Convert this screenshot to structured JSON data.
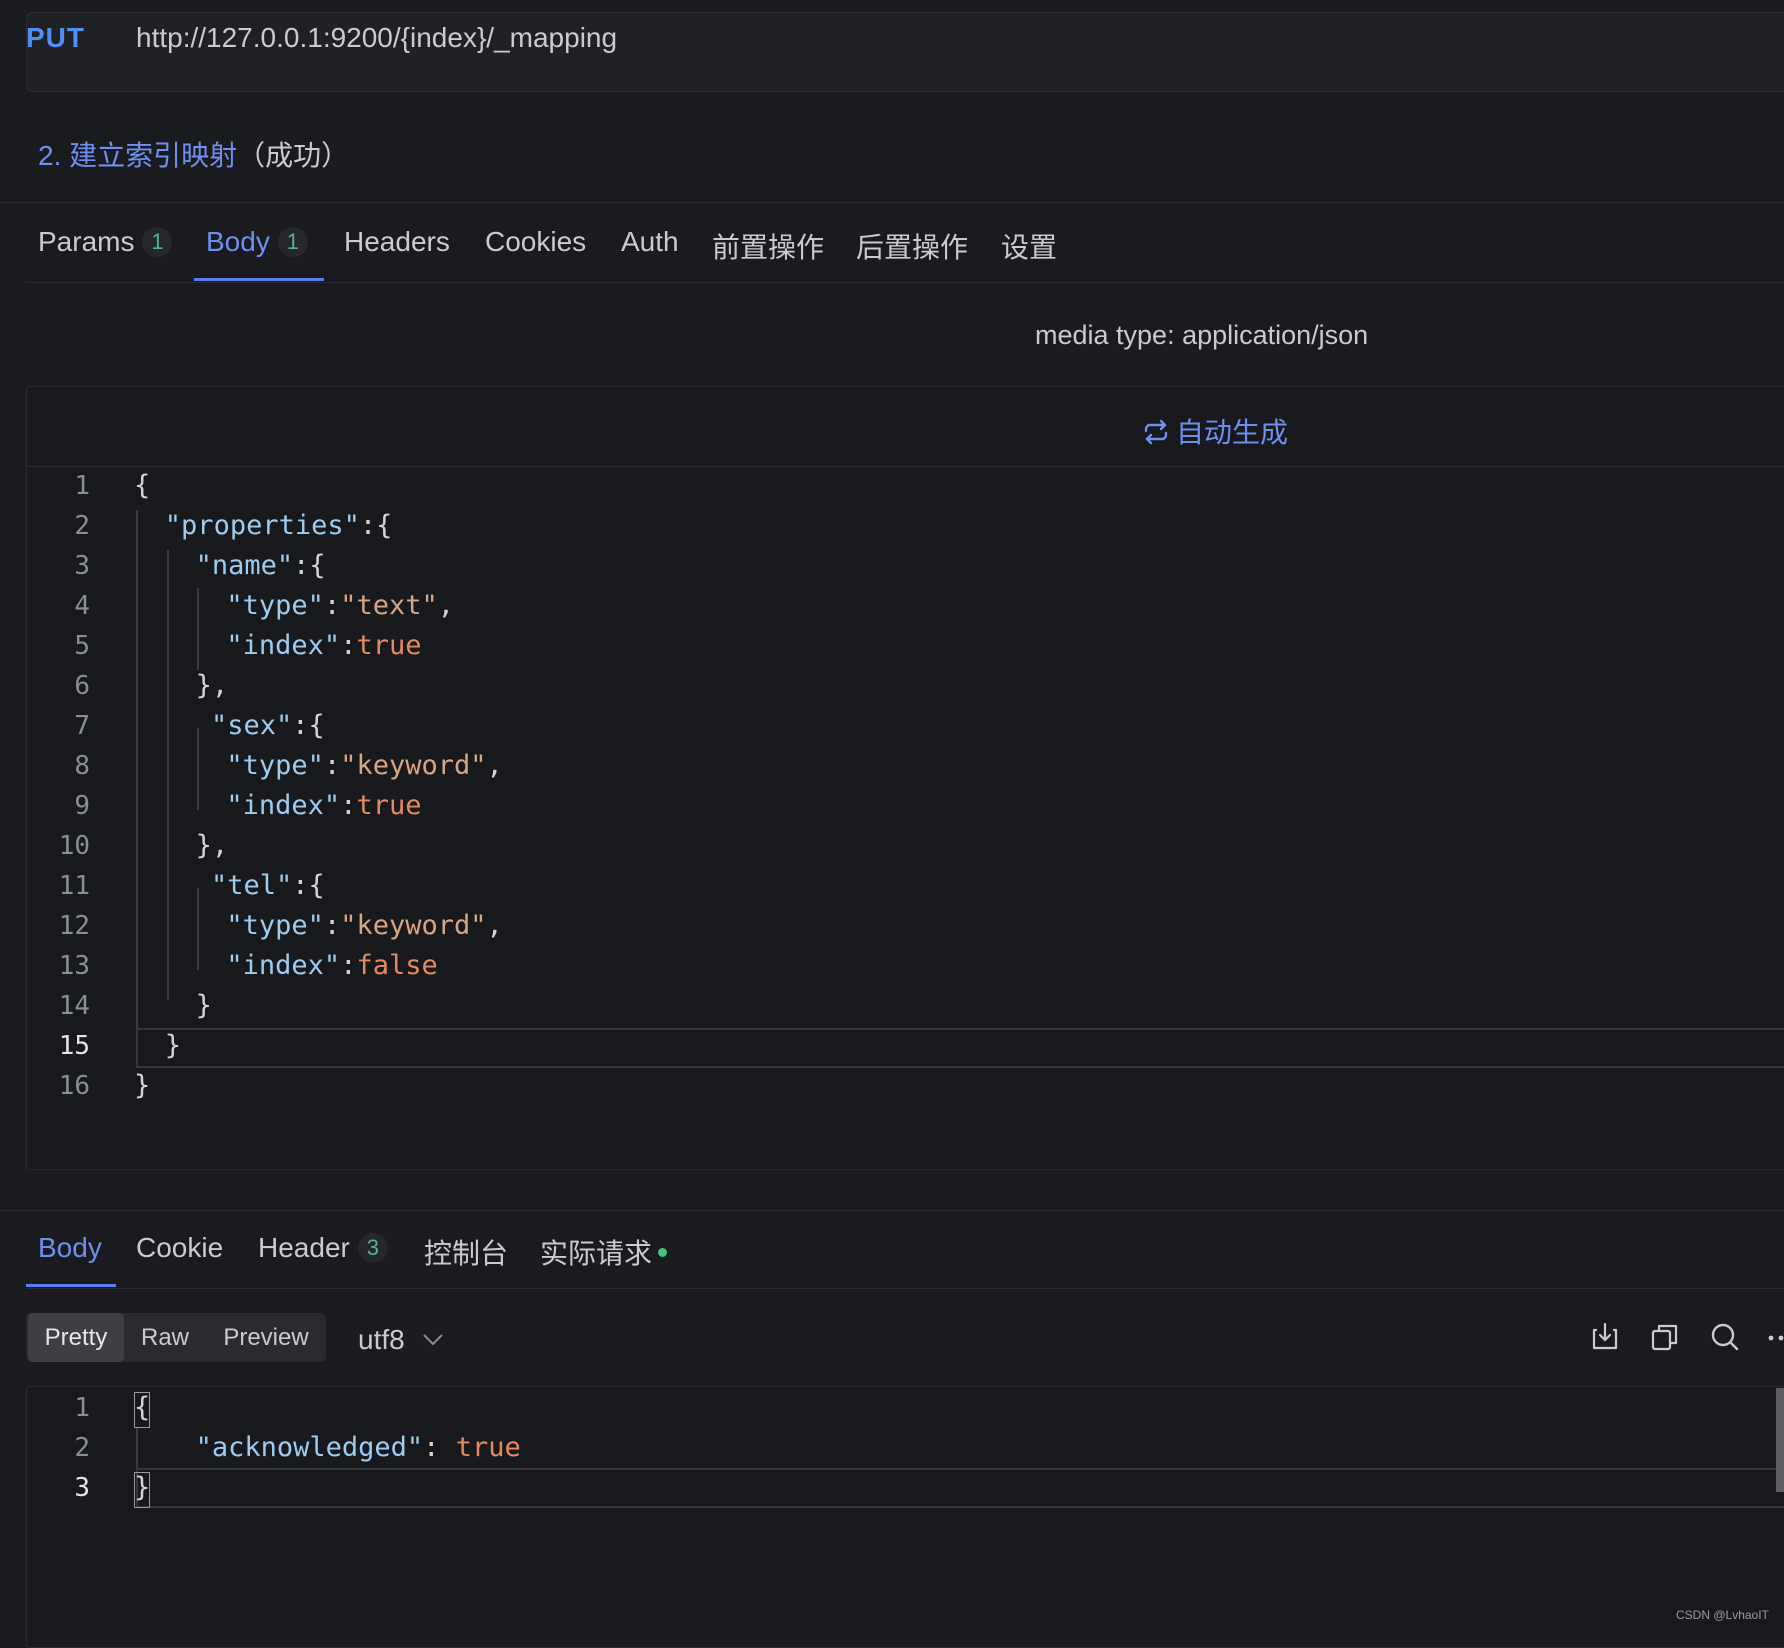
{
  "request": {
    "method": "PUT",
    "url": "http://127.0.0.1:9200/{index}/_mapping",
    "title_link": "2. 建立索引映射",
    "title_status": "（成功）"
  },
  "request_tabs": [
    {
      "label": "Params",
      "badge": "1"
    },
    {
      "label": "Body",
      "badge": "1",
      "active": true
    },
    {
      "label": "Headers"
    },
    {
      "label": "Cookies"
    },
    {
      "label": "Auth"
    },
    {
      "label": "前置操作"
    },
    {
      "label": "后置操作"
    },
    {
      "label": "设置"
    }
  ],
  "body": {
    "media_type": "media type: application/json",
    "auto_generate": "自动生成",
    "current_line": 15,
    "lines": [
      {
        "n": "1",
        "parts": [
          [
            "p",
            "{"
          ]
        ]
      },
      {
        "n": "2",
        "parts": [
          [
            "k",
            "\"properties\""
          ],
          [
            "p",
            ":{"
          ]
        ]
      },
      {
        "n": "3",
        "parts": [
          [
            "k",
            "\"name\""
          ],
          [
            "p",
            ":{"
          ]
        ]
      },
      {
        "n": "4",
        "parts": [
          [
            "k",
            "\"type\""
          ],
          [
            "p",
            ":"
          ],
          [
            "s",
            "\"text\""
          ],
          [
            "p",
            ","
          ]
        ]
      },
      {
        "n": "5",
        "parts": [
          [
            "k",
            "\"index\""
          ],
          [
            "p",
            ":"
          ],
          [
            "b",
            "true"
          ]
        ]
      },
      {
        "n": "6",
        "parts": [
          [
            "p",
            "},"
          ]
        ]
      },
      {
        "n": "7",
        "parts": [
          [
            "k",
            "\"sex\""
          ],
          [
            "p",
            ":{"
          ]
        ]
      },
      {
        "n": "8",
        "parts": [
          [
            "k",
            "\"type\""
          ],
          [
            "p",
            ":"
          ],
          [
            "s",
            "\"keyword\""
          ],
          [
            "p",
            ","
          ]
        ]
      },
      {
        "n": "9",
        "parts": [
          [
            "k",
            "\"index\""
          ],
          [
            "p",
            ":"
          ],
          [
            "b",
            "true"
          ]
        ]
      },
      {
        "n": "10",
        "parts": [
          [
            "p",
            "},"
          ]
        ]
      },
      {
        "n": "11",
        "parts": [
          [
            "k",
            "\"tel\""
          ],
          [
            "p",
            ":{"
          ]
        ]
      },
      {
        "n": "12",
        "parts": [
          [
            "k",
            "\"type\""
          ],
          [
            "p",
            ":"
          ],
          [
            "s",
            "\"keyword\""
          ],
          [
            "p",
            ","
          ]
        ]
      },
      {
        "n": "13",
        "parts": [
          [
            "k",
            "\"index\""
          ],
          [
            "p",
            ":"
          ],
          [
            "b",
            "false"
          ]
        ]
      },
      {
        "n": "14",
        "parts": [
          [
            "p",
            "}"
          ]
        ]
      },
      {
        "n": "15",
        "parts": [
          [
            "p",
            "}"
          ]
        ]
      },
      {
        "n": "16",
        "parts": [
          [
            "p",
            "}"
          ]
        ]
      }
    ]
  },
  "response_tabs": [
    {
      "label": "Body",
      "active": true
    },
    {
      "label": "Cookie"
    },
    {
      "label": "Header",
      "badge": "3"
    },
    {
      "label": "控制台"
    },
    {
      "label": "实际请求",
      "dot": true
    }
  ],
  "response": {
    "view_modes": [
      "Pretty",
      "Raw",
      "Preview"
    ],
    "active_view": "Pretty",
    "encoding": "utf8",
    "icons": [
      "download-icon",
      "copy-icon",
      "search-icon",
      "more-icon"
    ],
    "current_line": 3,
    "lines": [
      {
        "n": "1",
        "parts": [
          [
            "p",
            "{"
          ]
        ]
      },
      {
        "n": "2",
        "parts": [
          [
            "k",
            "\"acknowledged\""
          ],
          [
            "p",
            ": "
          ],
          [
            "b",
            "true"
          ]
        ]
      },
      {
        "n": "3",
        "parts": [
          [
            "p",
            "}"
          ]
        ]
      }
    ]
  },
  "watermark": "CSDN @LvhaoIT"
}
